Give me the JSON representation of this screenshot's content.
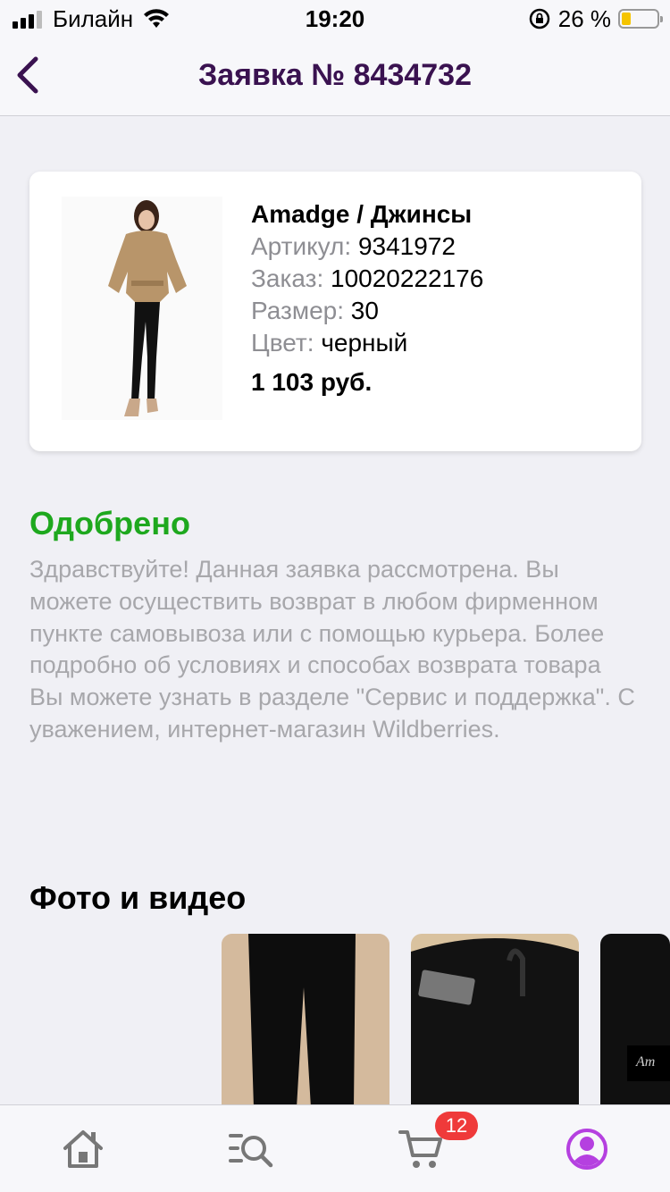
{
  "status_bar": {
    "carrier": "Билайн",
    "time": "19:20",
    "battery_percent": "26 %",
    "battery_level": 0.26
  },
  "nav": {
    "title": "Заявка № 8434732"
  },
  "product": {
    "name": "Amadge / Джинсы",
    "article_label": "Артикул:",
    "article_value": "9341972",
    "order_label": "Заказ:",
    "order_value": "10020222176",
    "size_label": "Размер:",
    "size_value": "30",
    "color_label": "Цвет:",
    "color_value": "черный",
    "price": "1 103 руб."
  },
  "status": {
    "title": "Одобрено",
    "message": "Здравствуйте! Данная заявка рассмотрена. Вы можете осуществить возврат в любом фирменном пункте самовывоза или с помощью курьера. Более подробно об условиях и способах возврата товара Вы можете узнать в разделе \"Сервис и поддержка\". С уважением, интернет-магазин Wildberries.",
    "color": "#1ea81e"
  },
  "media": {
    "title": "Фото и видео",
    "items": [
      "photo-1",
      "photo-2",
      "photo-3"
    ]
  },
  "tabbar": {
    "tabs": [
      "home-icon",
      "catalog-search-icon",
      "cart-icon",
      "profile-icon"
    ],
    "cart_badge": "12",
    "active_color": "#b540e0"
  },
  "colors": {
    "title_purple": "#3a1250",
    "badge_red": "#ef3a3a"
  }
}
